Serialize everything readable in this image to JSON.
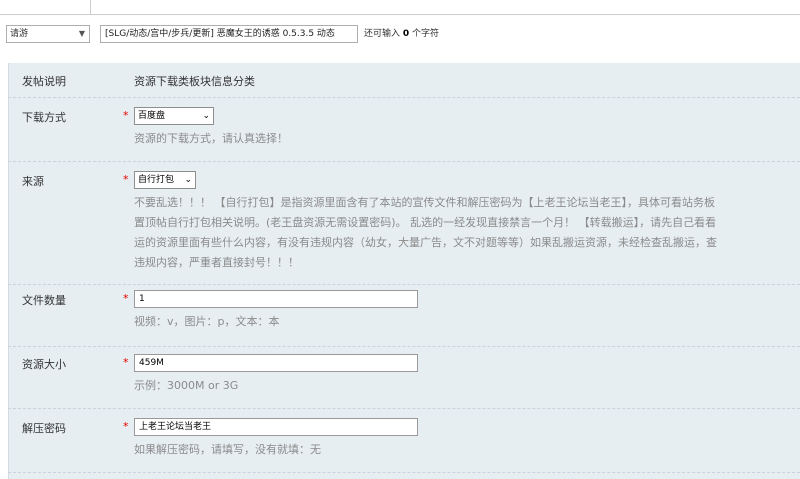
{
  "topbar": {
    "category_select": "请游",
    "title_value": "[SLG/动态/宫中/步兵/更新] 恶魔女王的诱惑 0.5.3.5 动态",
    "char_hint_prefix": "还可输入",
    "char_hint_count": "0",
    "char_hint_suffix": "个字符"
  },
  "form": {
    "header": {
      "label": "发帖说明",
      "value": "资源下载类板块信息分类"
    },
    "download": {
      "label": "下载方式",
      "required": "*",
      "select_value": "百度盘",
      "hint": "资源的下载方式，请认真选择！"
    },
    "source": {
      "label": "来源",
      "required": "*",
      "select_value": "自行打包",
      "hint_lines": [
        "不要乱选！！！ 【自行打包】是指资源里面含有了本站的宣传文件和解压密码为【上老王论坛当老王】，具体可看站务板",
        "置顶帖自行打包相关说明。(老王盘资源无需设置密码)。 乱选的一经发现直接禁言一个月！ 【转载搬运】，请先自己看看",
        "运的资源里面有些什么内容，有没有违规内容（幼女，大量广告，文不对题等等）如果乱搬运资源，未经检查乱搬运，查",
        "违规内容，严重者直接封号！！！"
      ]
    },
    "file_count": {
      "label": "文件数量",
      "required": "*",
      "value": "1",
      "hint": "视频：v，图片：p，文本：本"
    },
    "size": {
      "label": "资源大小",
      "required": "*",
      "value": "459M",
      "hint": "示例：3000M or 3G"
    },
    "password": {
      "label": "解压密码",
      "required": "*",
      "value": "上老王论坛当老王",
      "hint": "如果解压密码，请填写，没有就填：无"
    }
  },
  "icons": {
    "dropdown": "chevron-down-icon"
  }
}
